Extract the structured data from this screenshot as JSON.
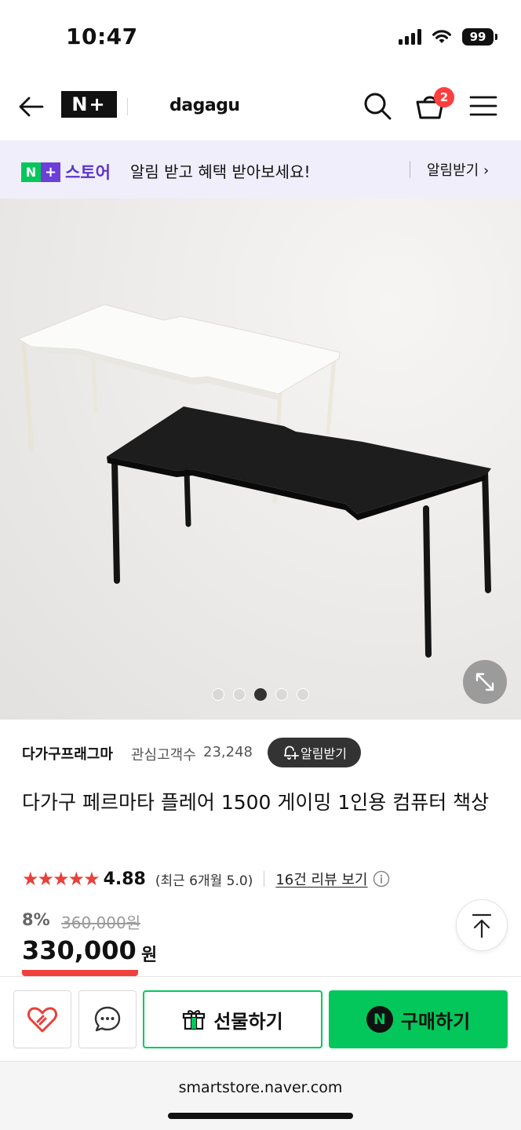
{
  "status_bar": {
    "time": "10:47",
    "battery": "99"
  },
  "header": {
    "logo": "N+",
    "brand": "dagagu",
    "cart_count": "2"
  },
  "notice": {
    "badge_n": "N",
    "badge_plus": "+",
    "store_label": "스토어",
    "message": "알림 받고 혜택 받아보세요!",
    "link_label": "알림받기 ›"
  },
  "gallery": {
    "image_count": 5,
    "active_index": 2
  },
  "seller": {
    "name": "다가구프래그마",
    "fan_label": "관심고객수",
    "fan_count": "23,248",
    "alarm_label": "알림받기"
  },
  "product": {
    "title": "다가구 페르마타 플레어 1500 게이밍 1인용 컴퓨터 책상"
  },
  "rating": {
    "stars": "★★★★★",
    "score": "4.88",
    "recent": "(최근 6개월 5.0)",
    "review_link": "16건 리뷰 보기"
  },
  "price": {
    "discount": "8%",
    "original": "360,000원",
    "sale": "330,000",
    "unit": "원"
  },
  "actions": {
    "gift_label": "선물하기",
    "buy_label": "구매하기",
    "npay_letter": "N"
  },
  "browser": {
    "url": "smartstore.naver.com"
  },
  "colors": {
    "naver_green": "#03c75a",
    "star_red": "#e8403a",
    "badge_red": "#ff3e3e",
    "store_purple": "#5a34c9"
  }
}
